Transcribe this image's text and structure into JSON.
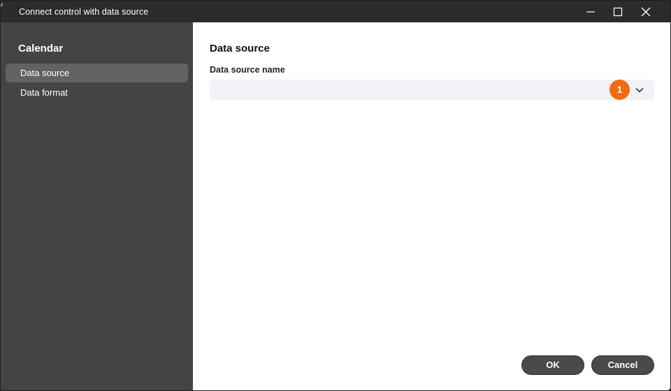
{
  "window": {
    "title": "Connect control with data source"
  },
  "sidebar": {
    "title": "Calendar",
    "items": [
      {
        "label": "Data source",
        "active": true
      },
      {
        "label": "Data format",
        "active": false
      }
    ]
  },
  "main": {
    "section_title": "Data source",
    "field_label": "Data source name",
    "select_value": "",
    "badge": "1"
  },
  "buttons": {
    "ok_label": "OK",
    "cancel_label": "Cancel"
  },
  "colors": {
    "accent_badge": "#f26a10",
    "sidebar_bg": "#444444",
    "titlebar_bg": "#2b2b2b"
  }
}
